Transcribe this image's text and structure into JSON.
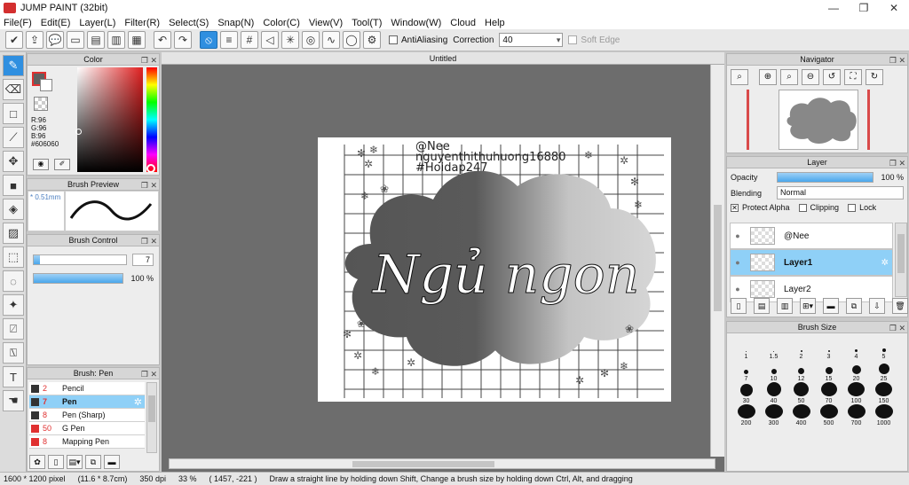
{
  "window": {
    "title": "JUMP PAINT (32bit)",
    "minimize": "—",
    "restore": "❐",
    "close": "✕"
  },
  "menu": [
    "File(F)",
    "Edit(E)",
    "Layer(L)",
    "Filter(R)",
    "Select(S)",
    "Snap(N)",
    "Color(C)",
    "View(V)",
    "Tool(T)",
    "Window(W)",
    "Cloud",
    "Help"
  ],
  "toolbar": {
    "antialiasing_label": "AntiAliasing",
    "correction_label": "Correction",
    "correction_value": "40",
    "soft_edge_label": "Soft Edge"
  },
  "color_panel": {
    "title": "Color",
    "r": "R:96",
    "g": "G:96",
    "b": "B:96",
    "hex": "#606060",
    "fg_color": "#606060"
  },
  "brush_preview": {
    "title": "Brush Preview",
    "size_label": "0.51mm"
  },
  "brush_control": {
    "title": "Brush Control",
    "size_value": "7",
    "size_fill": 0.07,
    "opacity_text": "100 %",
    "opacity_fill": 1.0
  },
  "brush_list": {
    "title": "Brush: Pen",
    "items": [
      {
        "size": "2",
        "name": "Pencil",
        "chip": "#333333"
      },
      {
        "size": "7",
        "name": "Pen",
        "chip": "#333333"
      },
      {
        "size": "8",
        "name": "Pen (Sharp)",
        "chip": "#333333"
      },
      {
        "size": "50",
        "name": "G Pen",
        "chip": "#e03030"
      },
      {
        "size": "8",
        "name": "Mapping Pen",
        "chip": "#e03030"
      }
    ]
  },
  "canvas": {
    "tab_title": "Untitled",
    "watermark_1": "@Nee",
    "watermark_2": "nguyenthithuhuong16880",
    "watermark_3": "#Hoidap247",
    "handwriting": "Ngủ ngon"
  },
  "navigator": {
    "title": "Navigator"
  },
  "layer_panel": {
    "title": "Layer",
    "opacity_label": "Opacity",
    "opacity_value": "100 %",
    "blending_label": "Blending",
    "blending_value": "Normal",
    "protect_alpha": "Protect Alpha",
    "clipping": "Clipping",
    "lock": "Lock",
    "layers": [
      {
        "name": "@Nee"
      },
      {
        "name": "Layer1"
      },
      {
        "name": "Layer2"
      }
    ]
  },
  "brush_size": {
    "title": "Brush Size",
    "sizes": [
      "1",
      "1.5",
      "2",
      "3",
      "4",
      "5",
      "7",
      "10",
      "12",
      "15",
      "20",
      "25",
      "30",
      "40",
      "50",
      "70",
      "100",
      "150",
      "200",
      "300",
      "400",
      "500",
      "700",
      "1000"
    ]
  },
  "status": {
    "dims": "1600 * 1200 pixel",
    "cm": "(11.6 * 8.7cm)",
    "dpi": "350 dpi",
    "zoom": "33 %",
    "coords": "( 1457, -221 )",
    "hint": "Draw a straight line by holding down Shift, Change a brush size by holding down Ctrl, Alt, and dragging"
  }
}
